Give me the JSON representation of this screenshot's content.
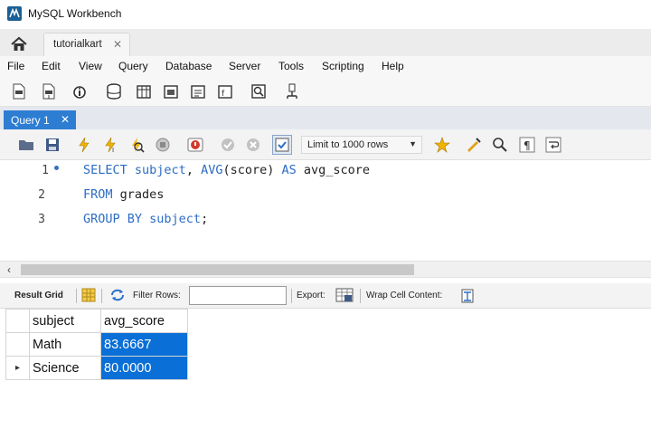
{
  "window": {
    "title": "MySQL Workbench"
  },
  "connection_tabs": [
    {
      "label": "tutorialkart",
      "close": "✕"
    }
  ],
  "menu": [
    "File",
    "Edit",
    "View",
    "Query",
    "Database",
    "Server",
    "Tools",
    "Scripting",
    "Help"
  ],
  "query_tab": {
    "label": "Query 1",
    "close": "✕"
  },
  "editor_toolbar": {
    "limit_label": "Limit to 1000 rows"
  },
  "editor": {
    "lines": [
      {
        "no": "1",
        "kw1": "SELECT",
        "id1": " subject",
        "p1": ", ",
        "fn": "AVG",
        "p2": "(score) ",
        "kw2": "AS",
        "p3": " avg_score"
      },
      {
        "no": "2",
        "kw1": "FROM",
        "rest": " grades"
      },
      {
        "no": "3",
        "kw1": "GROUP BY",
        "id1": " subject",
        "rest": ";"
      }
    ]
  },
  "result_toolbar": {
    "result_grid": "Result Grid",
    "filter_rows": "Filter Rows:",
    "filter_value": "",
    "export": "Export:",
    "wrap": "Wrap Cell Content:"
  },
  "result_grid": {
    "columns": [
      "subject",
      "avg_score"
    ],
    "rows": [
      [
        "Math",
        "83.6667"
      ],
      [
        "Science",
        "80.0000"
      ]
    ],
    "current_row_marker": "▸"
  },
  "colors": {
    "accent": "#2d7dd2",
    "selection": "#0a6fd6",
    "keyword": "#2c6cc4"
  }
}
